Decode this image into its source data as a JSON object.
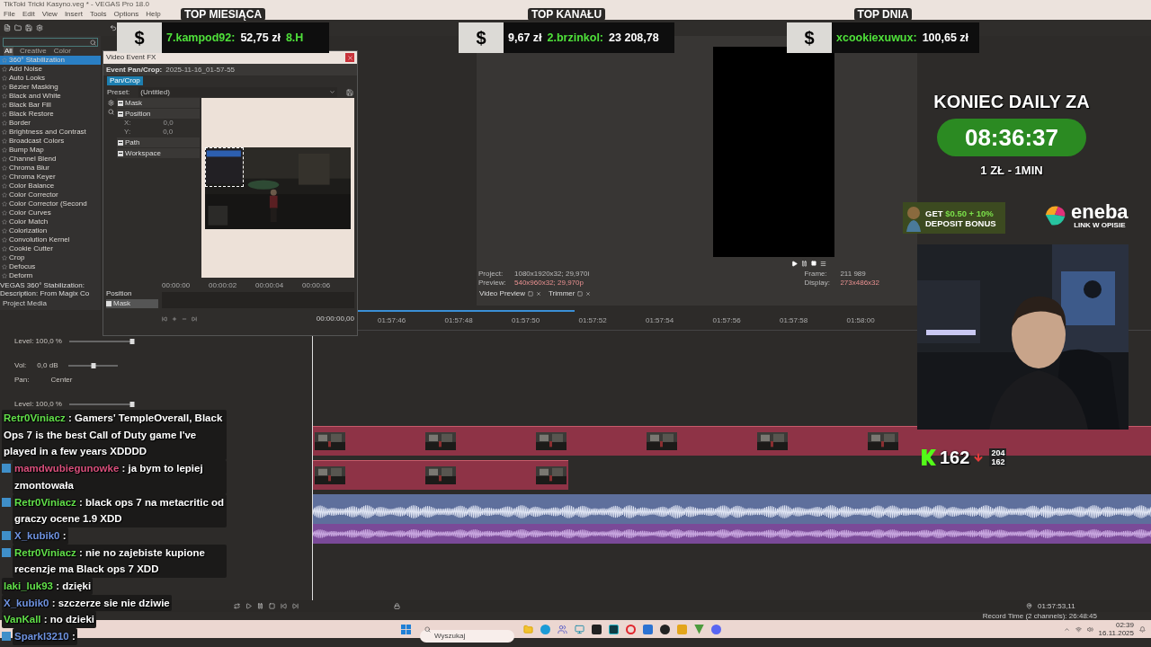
{
  "app": {
    "title": "TikToki Tricki Kasyno.veg * - VEGAS Pro 18.0",
    "menu": [
      "File",
      "Edit",
      "View",
      "Insert",
      "Tools",
      "Options",
      "Help"
    ]
  },
  "fx_panel": {
    "tabs": [
      {
        "label": "All",
        "selected": true
      },
      {
        "label": "Creative",
        "selected": false
      },
      {
        "label": "Color",
        "selected": false
      }
    ],
    "items": [
      {
        "label": "360° Stabilization",
        "selected": true
      },
      {
        "label": "Add Noise",
        "selected": false
      },
      {
        "label": "Auto Looks",
        "selected": false
      },
      {
        "label": "Bézier Masking",
        "selected": false
      },
      {
        "label": "Black and White",
        "selected": false
      },
      {
        "label": "Black Bar Fill",
        "selected": false
      },
      {
        "label": "Black Restore",
        "selected": false
      },
      {
        "label": "Border",
        "selected": false
      },
      {
        "label": "Brightness and Contrast",
        "selected": false
      },
      {
        "label": "Broadcast Colors",
        "selected": false
      },
      {
        "label": "Bump Map",
        "selected": false
      },
      {
        "label": "Channel Blend",
        "selected": false
      },
      {
        "label": "Chroma Blur",
        "selected": false
      },
      {
        "label": "Chroma Keyer",
        "selected": false
      },
      {
        "label": "Color Balance",
        "selected": false
      },
      {
        "label": "Color Corrector",
        "selected": false
      },
      {
        "label": "Color Corrector (Second",
        "selected": false
      },
      {
        "label": "Color Curves",
        "selected": false
      },
      {
        "label": "Color Match",
        "selected": false
      },
      {
        "label": "Colorization",
        "selected": false
      },
      {
        "label": "Convolution Kernel",
        "selected": false
      },
      {
        "label": "Cookie Cutter",
        "selected": false
      },
      {
        "label": "Crop",
        "selected": false
      },
      {
        "label": "Defocus",
        "selected": false
      },
      {
        "label": "Deform",
        "selected": false
      }
    ],
    "description": [
      "VEGAS 360° Stabilization:",
      "Description: From Magix Co"
    ],
    "bottom_tab": "Project Media"
  },
  "event_fx": {
    "title": "Video Event FX",
    "header": "Event Pan/Crop:",
    "event_name": "2025-11-16_01-57-55",
    "chip": "Pan/Crop",
    "preset_label": "Preset:",
    "preset_value": "(Untitled)",
    "tree": [
      {
        "label": "Mask",
        "expanded": true
      },
      {
        "label": "Position",
        "expanded": true,
        "children": [
          {
            "label": "X:",
            "value": "0,0"
          },
          {
            "label": "Y:",
            "value": "0,0"
          }
        ]
      },
      {
        "label": "Path",
        "expanded": true
      },
      {
        "label": "Workspace",
        "expanded": true
      }
    ],
    "keyframe_rows": [
      {
        "label": "Position",
        "kind": "plain"
      },
      {
        "label": "Mask",
        "kind": "check",
        "checked": true
      }
    ],
    "ticks": [
      "00:00:00",
      "00:00:02",
      "00:00:04",
      "00:00:06"
    ],
    "time": "00:00:00,00"
  },
  "preview": {
    "info_left": [
      {
        "label": "Project:",
        "value": "1080x1920x32; 29,970i"
      },
      {
        "label": "Preview:",
        "value": "540x960x32; 29,970p"
      }
    ],
    "info_right": [
      {
        "label": "Frame:",
        "value": "211 989"
      },
      {
        "label": "Display:",
        "value": "273x486x32"
      }
    ],
    "tabs": [
      "Video Preview",
      "Trimmer"
    ]
  },
  "timeline": {
    "ruler": [
      "01:57:46",
      "01:57:48",
      "01:57:50",
      "01:57:52",
      "01:57:54",
      "01:57:56",
      "01:57:58",
      "01:58:00"
    ],
    "headers": [
      {
        "kind": "level",
        "label": "Level: 100,0 %",
        "level": 1
      },
      {
        "kind": "volume",
        "vol_label": "Vol:",
        "vol_value": "0,0 dB",
        "level": 0.5,
        "pan_label": "Pan:",
        "pan_value": "Center"
      },
      {
        "kind": "level",
        "label": "Level: 100,0 %",
        "level": 1
      }
    ],
    "cursor_time": "01:57:53,11",
    "record_time": "Record Time (2 channels): 26:48:45"
  },
  "overlay": {
    "top_boxes": [
      {
        "title": "TOP MIESIĄCA",
        "symbol": "$",
        "segments": [
          {
            "kind": "name",
            "text": "7.kampod92:"
          },
          {
            "kind": "amount",
            "text": "52,75 zł"
          },
          {
            "kind": "name",
            "text": "8.H"
          }
        ]
      },
      {
        "title": "TOP KANAŁU",
        "symbol": "$",
        "segments": [
          {
            "kind": "amount",
            "text": "9,67 zł"
          },
          {
            "kind": "name",
            "text": "2.brzinkol:"
          },
          {
            "kind": "amount",
            "text": "23 208,78"
          }
        ]
      },
      {
        "title": "TOP DNIA",
        "symbol": "$",
        "segments": [
          {
            "kind": "name",
            "text": "xcookiexuwux:"
          },
          {
            "kind": "amount",
            "text": "100,65 zł"
          }
        ]
      }
    ],
    "countdown": {
      "title": "KONIEC DAILY ZA",
      "time": "08:36:37",
      "rate": "1 ZŁ - 1MIN"
    },
    "bonus": {
      "lead": "GET",
      "highlight": "$0.50 + 10%",
      "line2": "DEPOSIT BONUS"
    },
    "sponsor": {
      "name": "eneba",
      "tagline": "LINK W OPISIE"
    },
    "viewers": {
      "count": "162",
      "stat_1": "204",
      "stat_2": "162"
    },
    "chat": [
      {
        "user": "Retr0Viniacz",
        "color": "#62e04a",
        "badge": false,
        "text": ": Gamers' TempleOverall, Black Ops 7 is the best Call of Duty game I've played in a few years XDDDD"
      },
      {
        "user": "mamdwubiegunowke",
        "color": "#d9507c",
        "badge": true,
        "text": ": ja bym to lepiej zmontowała"
      },
      {
        "user": "Retr0Viniacz",
        "color": "#62e04a",
        "badge": true,
        "text": ": black ops 7 na metacritic od graczy ocene 1.9 XDD"
      },
      {
        "user": "X_kubik0",
        "color": "#6f93e0",
        "badge": true,
        "text": ":"
      },
      {
        "user": "Retr0Viniacz",
        "color": "#62e04a",
        "badge": true,
        "text": ": nie no zajebiste kupione recenzje ma Black ops 7 XDD"
      },
      {
        "user": "laki_luk93",
        "color": "#62e04a",
        "badge": false,
        "text": ": dzięki"
      },
      {
        "user": "X_kubik0",
        "color": "#6f93e0",
        "badge": false,
        "text": ": szczerze sie nie dziwie"
      },
      {
        "user": "VanKall",
        "color": "#62e04a",
        "badge": false,
        "text": ": no dzieki"
      },
      {
        "user": "Sparkl3210",
        "color": "#6f93e0",
        "badge": true,
        "text": ":"
      }
    ]
  },
  "taskbar": {
    "search_placeholder": "Wyszukaj",
    "time": "02:39",
    "date": "16.11.2025"
  }
}
